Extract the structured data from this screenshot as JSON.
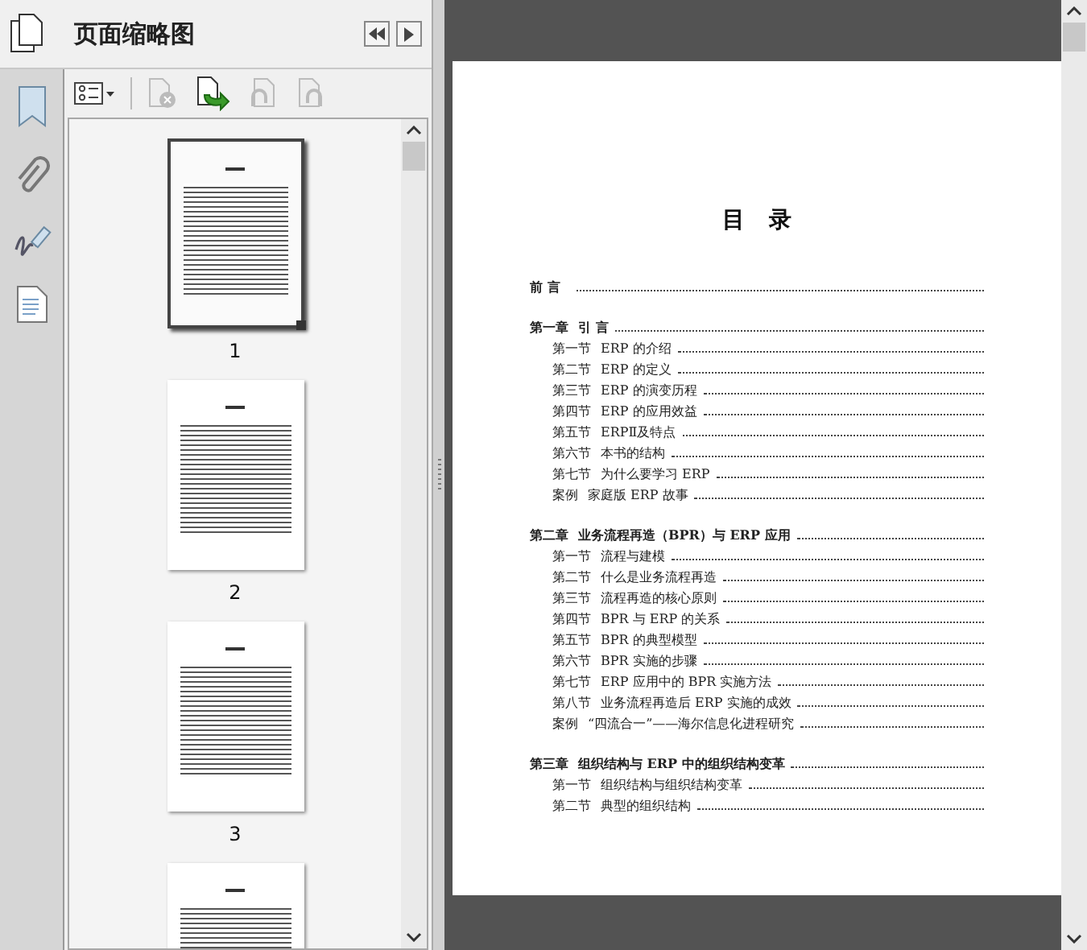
{
  "panel": {
    "title": "页面缩略图"
  },
  "thumbnails": [
    {
      "label": "1",
      "selected": true
    },
    {
      "label": "2",
      "selected": false
    },
    {
      "label": "3",
      "selected": false
    },
    {
      "selected": false
    }
  ],
  "document": {
    "title": "目 录",
    "groups": [
      {
        "heading": {
          "number": "前 言"
        }
      },
      {
        "heading": {
          "number": "第一章",
          "title": "引 言"
        },
        "items": [
          {
            "number": "第一节",
            "title": "ERP 的介绍"
          },
          {
            "number": "第二节",
            "title": "ERP 的定义"
          },
          {
            "number": "第三节",
            "title": "ERP 的演变历程"
          },
          {
            "number": "第四节",
            "title": "ERP 的应用效益"
          },
          {
            "number": "第五节",
            "title": "ERPⅡ及特点"
          },
          {
            "number": "第六节",
            "title": "本书的结构"
          },
          {
            "number": "第七节",
            "title": "为什么要学习 ERP"
          },
          {
            "number": "案例",
            "title": "家庭版 ERP 故事"
          }
        ]
      },
      {
        "heading": {
          "number": "第二章",
          "title": "业务流程再造（BPR）与 ERP 应用"
        },
        "items": [
          {
            "number": "第一节",
            "title": "流程与建模"
          },
          {
            "number": "第二节",
            "title": "什么是业务流程再造"
          },
          {
            "number": "第三节",
            "title": "流程再造的核心原则"
          },
          {
            "number": "第四节",
            "title": "BPR 与 ERP 的关系"
          },
          {
            "number": "第五节",
            "title": "BPR 的典型模型"
          },
          {
            "number": "第六节",
            "title": "BPR 实施的步骤"
          },
          {
            "number": "第七节",
            "title": "ERP 应用中的 BPR 实施方法"
          },
          {
            "number": "第八节",
            "title": "业务流程再造后 ERP 实施的成效"
          },
          {
            "number": "案例",
            "title": "“四流合一”——海尔信息化进程研究"
          }
        ]
      },
      {
        "heading": {
          "number": "第三章",
          "title": "组织结构与 ERP 中的组织结构变革"
        },
        "items": [
          {
            "number": "第一节",
            "title": "组织结构与组织结构变革"
          },
          {
            "number": "第二节",
            "title": "典型的组织结构"
          }
        ]
      }
    ]
  }
}
